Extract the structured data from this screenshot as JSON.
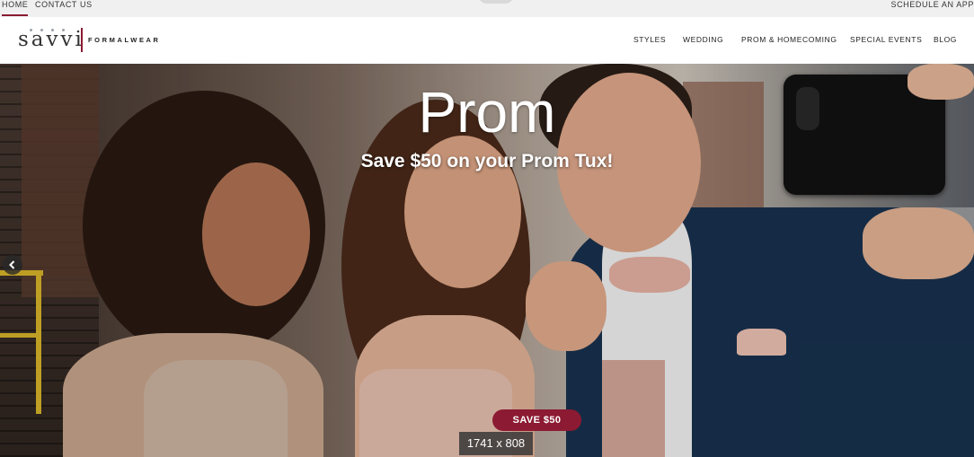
{
  "utility_bar": {
    "home": "HOME",
    "contact": "CONTACT US",
    "schedule": "SCHEDULE AN APP"
  },
  "header": {
    "logo_word": "savvi",
    "logo_sub": "FORMALWEAR",
    "nav": [
      "STYLES",
      "WEDDING",
      "PROM & HOMECOMING",
      "SPECIAL EVENTS",
      "BLOG"
    ]
  },
  "hero": {
    "title": "Prom",
    "subtitle": "Save $50 on your Prom Tux!",
    "cta": "SAVE $50",
    "image_dimensions": "1741 x 808",
    "prev_icon": "chevron-left-icon"
  },
  "colors": {
    "accent": "#8b1a32",
    "utility_bg": "#f0f0f0"
  }
}
